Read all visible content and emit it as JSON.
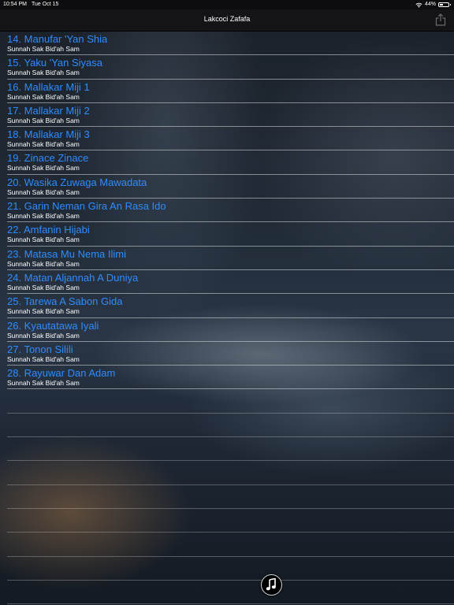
{
  "status_bar": {
    "time": "10:54 PM",
    "date": "Tue Oct 15",
    "battery": "44%",
    "battery_level": 0.44
  },
  "nav": {
    "title": "Lakcoci Zafafa",
    "share_icon": "share-icon"
  },
  "items": [
    {
      "title": "14. Manufar 'Yan Shia",
      "subtitle": "Sunnah Sak Bid'ah Sam"
    },
    {
      "title": "15. Yaku 'Yan Siyasa",
      "subtitle": "Sunnah Sak Bid'ah Sam"
    },
    {
      "title": "16. Mallakar Miji 1",
      "subtitle": "Sunnah Sak Bid'ah Sam"
    },
    {
      "title": "17. Mallakar Miji 2",
      "subtitle": "Sunnah Sak Bid'ah Sam"
    },
    {
      "title": "18. Mallakar Miji 3",
      "subtitle": "Sunnah Sak Bid'ah Sam"
    },
    {
      "title": "19. Zinace Zinace",
      "subtitle": "Sunnah Sak Bid'ah Sam"
    },
    {
      "title": "20. Wasika Zuwaga Mawadata",
      "subtitle": "Sunnah Sak Bid'ah Sam"
    },
    {
      "title": "21. Garin Neman Gira An Rasa Ido",
      "subtitle": "Sunnah Sak Bid'ah Sam"
    },
    {
      "title": "22. Amfanin Hijabi",
      "subtitle": "Sunnah Sak Bid'ah Sam"
    },
    {
      "title": "23. Matasa Mu Nema Ilimi",
      "subtitle": "Sunnah Sak Bid'ah Sam"
    },
    {
      "title": "24. Matan Aljannah A Duniya",
      "subtitle": "Sunnah Sak Bid'ah Sam"
    },
    {
      "title": "25. Tarewa A Sabon Gida",
      "subtitle": "Sunnah Sak Bid'ah Sam"
    },
    {
      "title": "26. Kyautatawa Iyali",
      "subtitle": "Sunnah Sak Bid'ah Sam"
    },
    {
      "title": "27. Tonon Silili",
      "subtitle": "Sunnah Sak Bid'ah Sam"
    },
    {
      "title": "28. Rayuwar Dan Adam",
      "subtitle": "Sunnah Sak Bid'ah Sam"
    }
  ],
  "player": {
    "icon": "music-note-icon"
  },
  "colors": {
    "title_text": "#2f8cff",
    "subtitle_text": "#ffffff",
    "nav_background": "#141416"
  }
}
